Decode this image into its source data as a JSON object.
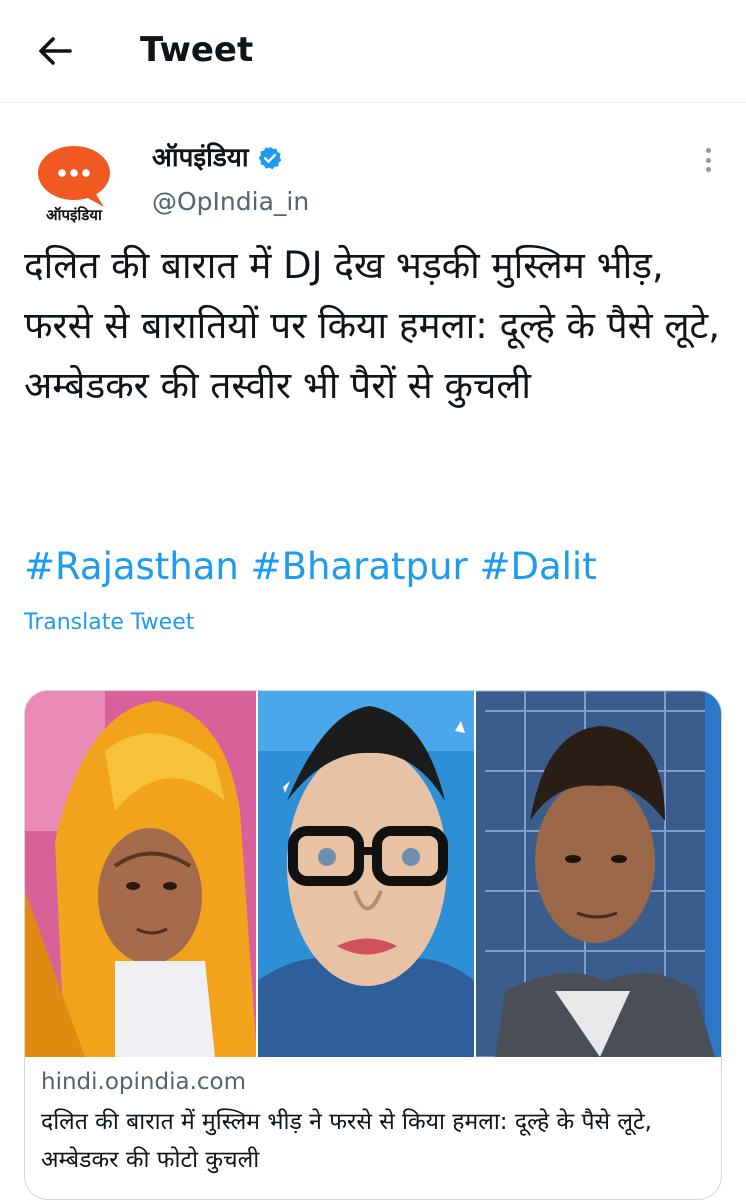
{
  "header": {
    "title": "Tweet",
    "back_icon": "arrow-left-icon"
  },
  "author": {
    "display_name": "ऑपइंडिया",
    "handle": "@OpIndia_in",
    "avatar_caption": "ऑपइंडिया",
    "verified": true,
    "verified_color": "#1d9bf0",
    "avatar_color": "#f05a22"
  },
  "tweet": {
    "text": "दलित की बारात में DJ देख भड़की मुस्लिम भीड़, फरसे से बारातियों पर किया हमला: दूल्हे के पैसे लूटे, अम्बेडकर की तस्वीर भी पैरों से कुचली",
    "hashtags": [
      "#Rajasthan",
      "#Bharatpur",
      "#Dalit"
    ],
    "translate_label": "Translate Tweet",
    "link_color": "#1d9bf0"
  },
  "card": {
    "domain": "hindi.opindia.com",
    "title": "दलित की बारात में मुस्लिम भीड़ ने फरसे से किया हमला: दूल्हे के पैसे लूटे, अम्बेडकर की फोटो कुचली"
  }
}
